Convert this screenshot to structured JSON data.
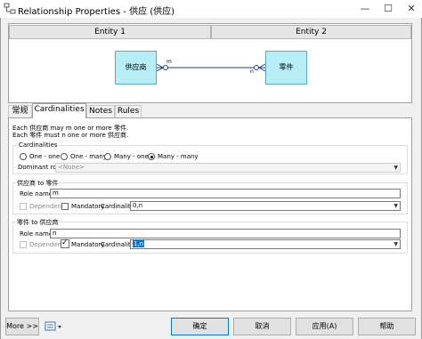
{
  "window": {
    "title": "Relationship Properties - 供应 (供应)",
    "minimize": "—",
    "maximize": "☐",
    "close": "✕"
  },
  "diagram": {
    "entity1_header": "Entity 1",
    "entity2_header": "Entity 2",
    "entity1_name": "供应商",
    "entity2_name": "零件",
    "role_label_1": "m",
    "role_label_2": "n"
  },
  "tabs": [
    "常规",
    "Cardinalities",
    "Notes",
    "Rules"
  ],
  "cardinalities_tab": {
    "desc_line1": "Each 供应商 may m one or more 零件.",
    "desc_line2": "Each 零件 must n one or more 供应商.",
    "group_title": "Cardinalities",
    "options": [
      "One - one",
      "One - many",
      "Many - one",
      "Many - many"
    ],
    "selected_option": "Many - many",
    "dominant_role_label": "Dominant role:",
    "dominant_role_value": "<None>",
    "section1": {
      "title": "供应商 to 零件",
      "role_name_label": "Role name:",
      "role_name_value": "m",
      "dependent_label": "Dependent",
      "mandatory_label": "Mandatory",
      "cardinality_label": "Cardinality:",
      "cardinality_value": "0,n"
    },
    "section2": {
      "title": "零件 to 供应商",
      "role_name_label": "Role name:",
      "role_name_value": "n",
      "dependent_label": "Dependent",
      "mandatory_label": "Mandatory",
      "cardinality_label": "Cardinality:",
      "cardinality_value": "1,n"
    }
  },
  "footer": {
    "more": "More >>",
    "ok": "确定",
    "cancel": "取消",
    "apply": "应用(A)",
    "help": "帮助"
  }
}
